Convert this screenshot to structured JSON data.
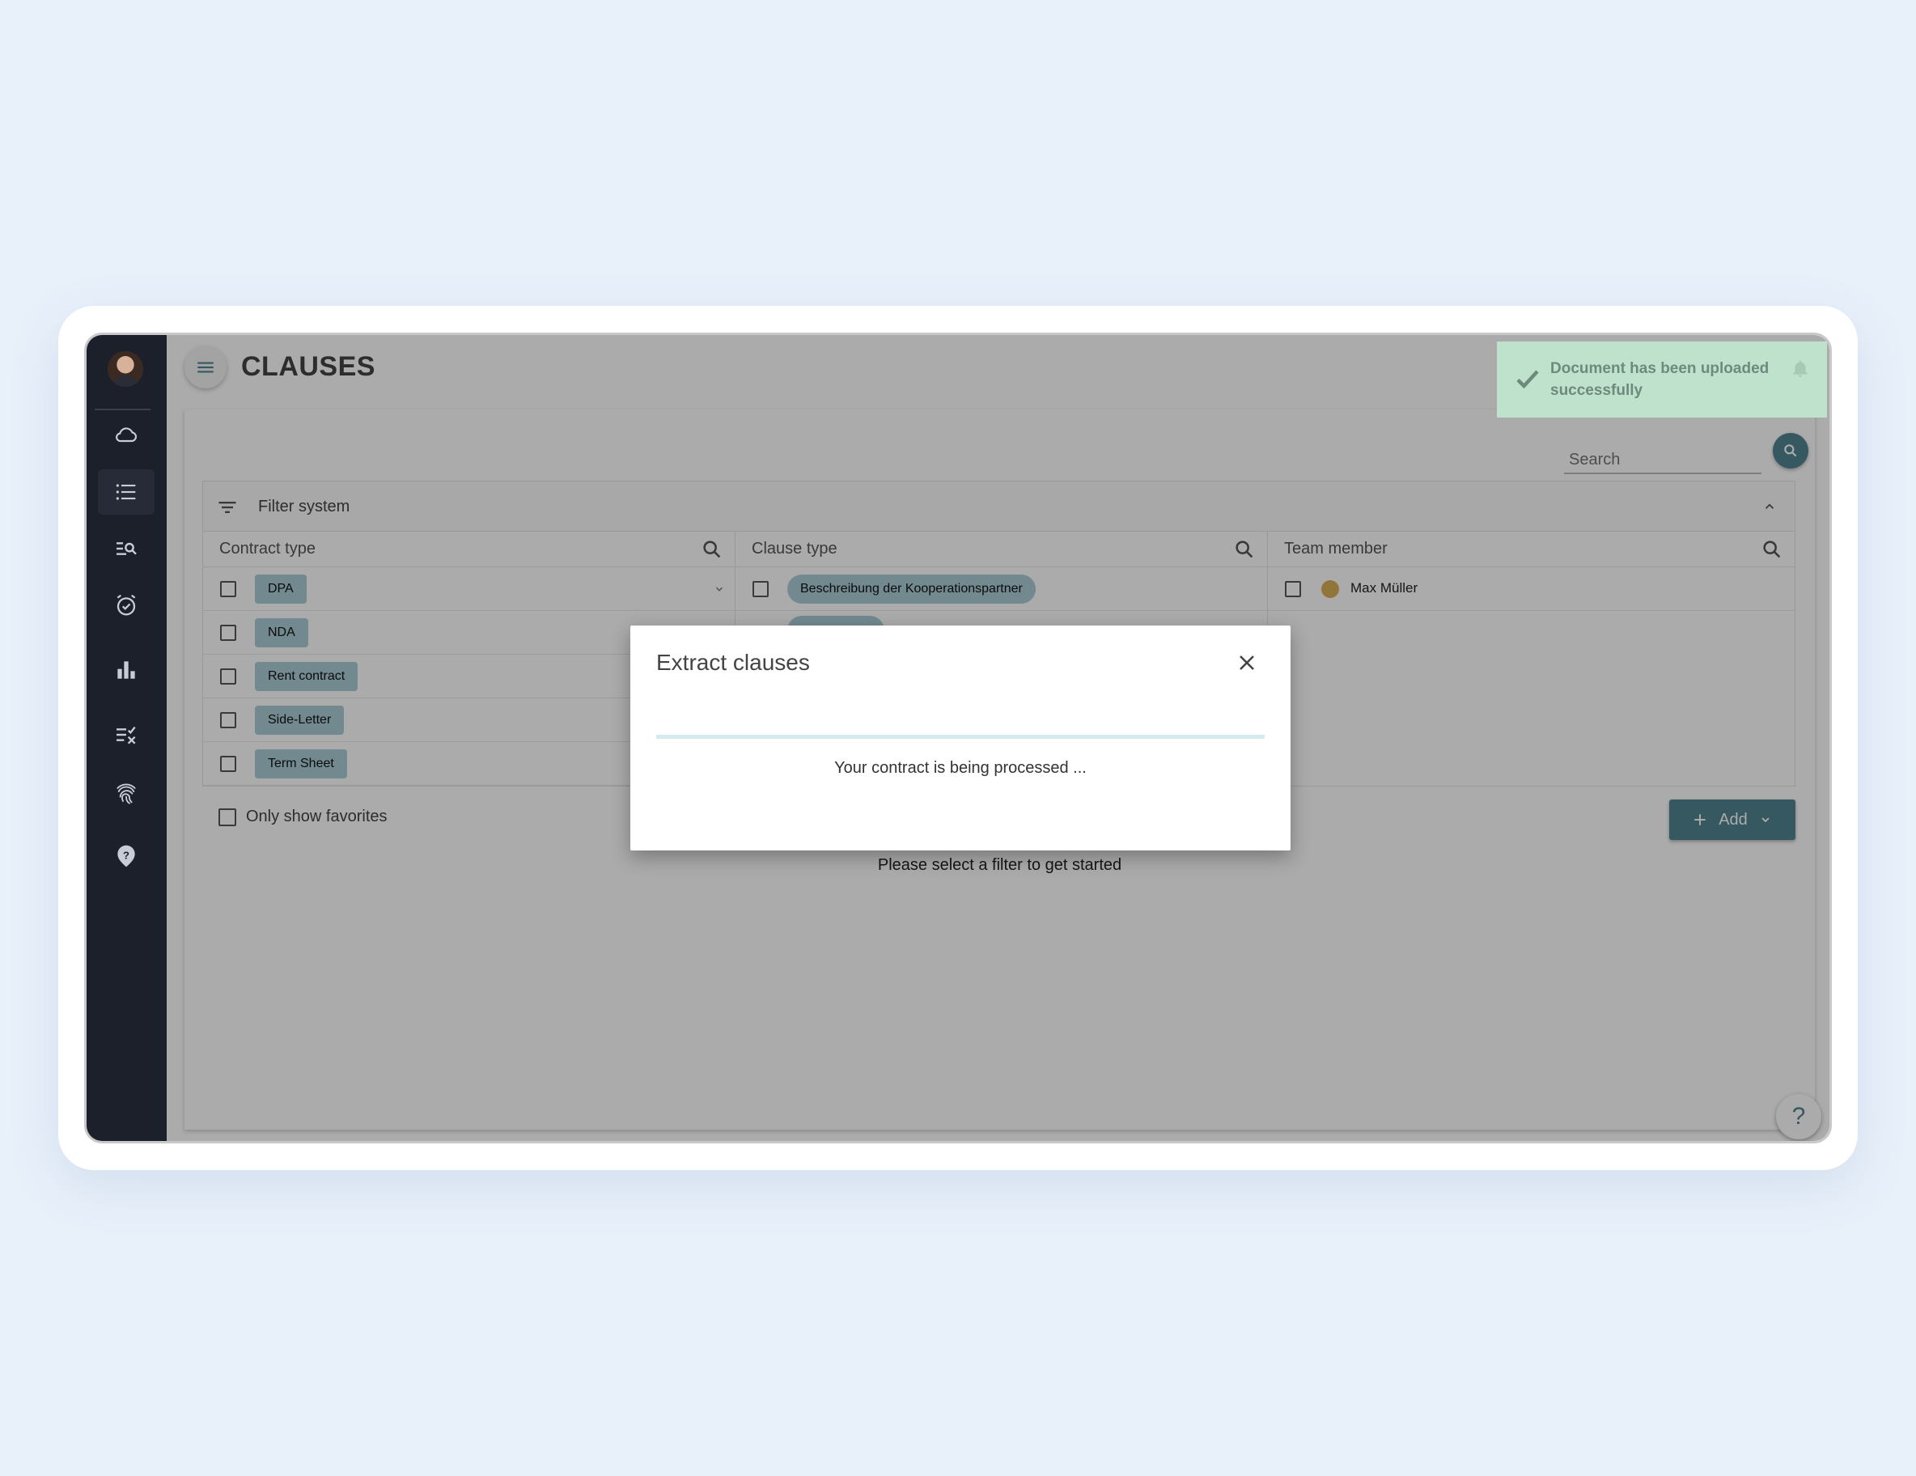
{
  "app": {
    "page_title": "CLAUSES",
    "search": {
      "placeholder": "Search"
    }
  },
  "sidebar": {
    "items": [
      {
        "icon": "cloud-icon"
      },
      {
        "icon": "list-icon",
        "active": true
      },
      {
        "icon": "search-list-icon"
      },
      {
        "icon": "alarm-icon"
      },
      {
        "icon": "bar-chart-icon"
      },
      {
        "icon": "checklist-icon"
      },
      {
        "icon": "fingerprint-icon"
      },
      {
        "icon": "help-icon"
      }
    ]
  },
  "filter": {
    "title": "Filter system",
    "columns": {
      "contract_type": {
        "label": "Contract type",
        "items": [
          "DPA",
          "NDA",
          "Rent contract",
          "Side-Letter",
          "Term Sheet"
        ]
      },
      "clause_type": {
        "label": "Clause type",
        "items": [
          "Beschreibung der Kooperationspartner"
        ]
      },
      "team_member": {
        "label": "Team member",
        "items": [
          "Max Müller"
        ]
      }
    },
    "only_favorites_label": "Only show favorites"
  },
  "add_button_label": "Add",
  "empty_message": "Please select a filter to get started",
  "toast": {
    "message": "Document has been uploaded successfully"
  },
  "modal": {
    "title": "Extract clauses",
    "status_text": "Your contract is being processed ..."
  },
  "help_fab_label": "?",
  "colors": {
    "accent": "#4f8491",
    "chip": "#a9cdd5",
    "sidebar": "#1c202b",
    "toast": "#bfe2cc"
  }
}
